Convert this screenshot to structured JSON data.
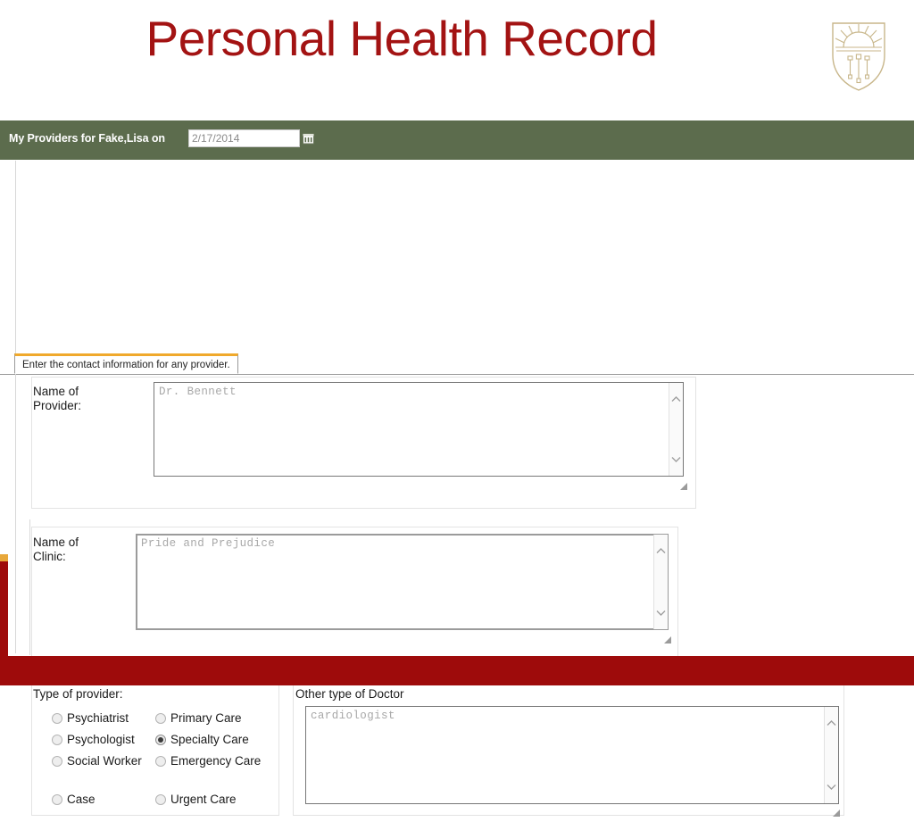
{
  "slide": {
    "title": "Personal Health Record",
    "title_color": "#a31313",
    "logo_name": "university-crest-logo",
    "accent_red": "#9e0b0b",
    "accent_orange": "#e8a83a"
  },
  "green_bar": {
    "background": "#5c6c4d",
    "heading": "My Providers for Fake,Lisa on",
    "date_value": "2/17/2014",
    "date_placeholder": "2/17/2014",
    "calendar_icon": "calendar-icon"
  },
  "tabs": [
    {
      "label": "Enter the contact information for any provider.",
      "active": true
    }
  ],
  "fields": {
    "provider": {
      "label": "Name of\nProvider:",
      "value": "",
      "placeholder": "Dr. Bennett"
    },
    "clinic": {
      "label": "Name of\nClinic:",
      "value": "",
      "placeholder": "Pride and Prejudice"
    },
    "other_doctor": {
      "label": "Other type of Doctor",
      "value": "",
      "placeholder": "cardiologist"
    }
  },
  "provider_type": {
    "label": "Type of provider:",
    "selected": "Specialty Care",
    "rows": [
      {
        "left": "Psychiatrist",
        "right": "Primary Care"
      },
      {
        "left": "Psychologist",
        "right": "Specialty Care"
      },
      {
        "left": "Social Worker",
        "right": "Emergency Care"
      }
    ],
    "last_row": {
      "left": "Case",
      "right": "Urgent Care"
    }
  }
}
